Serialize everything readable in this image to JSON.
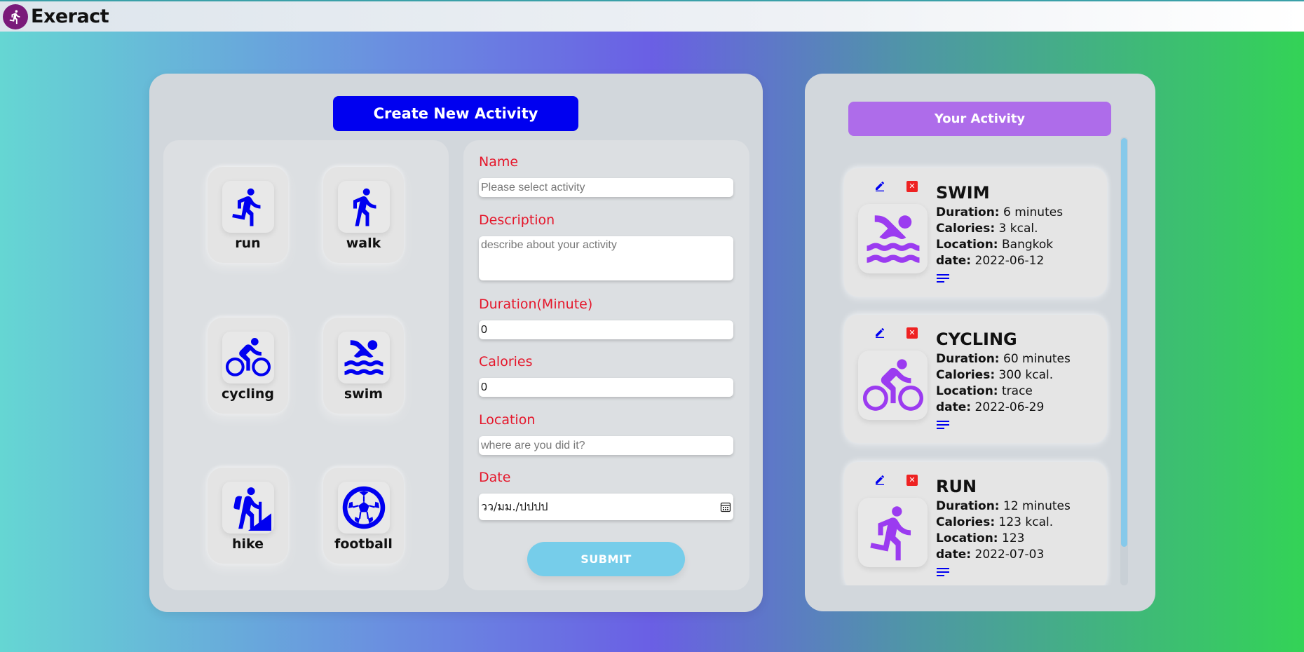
{
  "app": {
    "title": "Exeract"
  },
  "create": {
    "title": "Create New Activity",
    "activities": [
      {
        "label": "run",
        "icon": "run-icon"
      },
      {
        "label": "walk",
        "icon": "walk-icon"
      },
      {
        "label": "cycling",
        "icon": "cycling-icon"
      },
      {
        "label": "swim",
        "icon": "swim-icon"
      },
      {
        "label": "hike",
        "icon": "hike-icon"
      },
      {
        "label": "football",
        "icon": "football-icon"
      }
    ],
    "form": {
      "name_label": "Name",
      "name_placeholder": "Please select activity",
      "description_label": "Description",
      "description_placeholder": "describe about your activity",
      "duration_label": "Duration(Minute)",
      "duration_value": "0",
      "calories_label": "Calories",
      "calories_value": "0",
      "location_label": "Location",
      "location_placeholder": "where are you did it?",
      "date_label": "Date",
      "date_placeholder": "วว/มม./ปปปป",
      "submit_label": "SUBMIT"
    }
  },
  "your_activity": {
    "title": "Your Activity",
    "field_labels": {
      "duration": "Duration:",
      "calories": "Calories:",
      "location": "Location:",
      "date": "date:"
    },
    "items": [
      {
        "title": "SWIM",
        "duration": "6 minutes",
        "calories": "3 kcal.",
        "location": "Bangkok",
        "date": "2022-06-12",
        "icon": "swim-icon"
      },
      {
        "title": "CYCLING",
        "duration": "60 minutes",
        "calories": "300 kcal.",
        "location": "trace",
        "date": "2022-06-29",
        "icon": "cycling-icon"
      },
      {
        "title": "RUN",
        "duration": "12 minutes",
        "calories": "123 kcal.",
        "location": "123",
        "date": "2022-07-03",
        "icon": "run-icon"
      }
    ]
  },
  "colors": {
    "create_button": "#0000f0",
    "your_activity_button": "#ae6cea",
    "activity_icon_blue": "#0000f0",
    "card_icon_purple": "#9b3bf0",
    "form_label": "#e5162a",
    "submit": "#76cdea"
  }
}
